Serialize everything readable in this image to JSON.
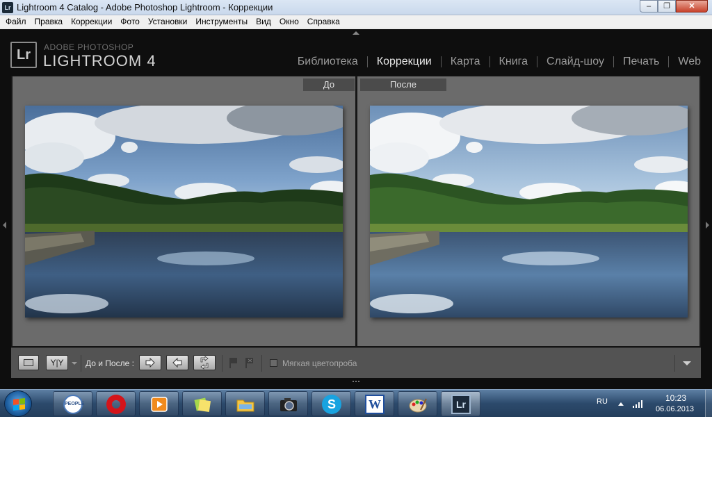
{
  "window": {
    "app_icon_text": "Lr",
    "title": "Lightroom 4 Catalog - Adobe Photoshop Lightroom - Коррекции",
    "minimize_glyph": "–",
    "maximize_glyph": "❐",
    "close_glyph": "✕"
  },
  "menubar": {
    "items": [
      "Файл",
      "Правка",
      "Коррекции",
      "Фото",
      "Установки",
      "Инструменты",
      "Вид",
      "Окно",
      "Справка"
    ]
  },
  "lightroom": {
    "logo_mark": "Lr",
    "logo_line1": "ADOBE PHOTOSHOP",
    "logo_line2": "LIGHTROOM 4",
    "modules": [
      "Библиотека",
      "Коррекции",
      "Карта",
      "Книга",
      "Слайд-шоу",
      "Печать",
      "Web"
    ],
    "active_module": "Коррекции"
  },
  "compare": {
    "before_label": "До",
    "after_label": "После"
  },
  "toolbar": {
    "yy_label": "Y|Y",
    "before_after_label": "До и После :",
    "soft_proof_label": "Мягкая цветопроба",
    "soft_proof_checked": false
  },
  "taskbar": {
    "apps": [
      "people-net-icon",
      "opera-icon",
      "media-player-icon",
      "sticky-notes-icon",
      "explorer-icon",
      "camera-icon",
      "skype-icon",
      "word-icon",
      "paint-icon",
      "lightroom-icon"
    ],
    "active_app": "lightroom-icon",
    "word_glyph": "W",
    "lr_glyph": "Lr",
    "people_text": "PEOPLE",
    "language": "RU",
    "time": "10:23",
    "date": "06.06.2013"
  },
  "colors": {
    "lr_background": "#0e0e0e",
    "panel_gray": "#6b6b6b",
    "toolbar_gray": "#535353",
    "active_module": "#e8e8e8",
    "inactive_module": "#9a9a9a"
  }
}
